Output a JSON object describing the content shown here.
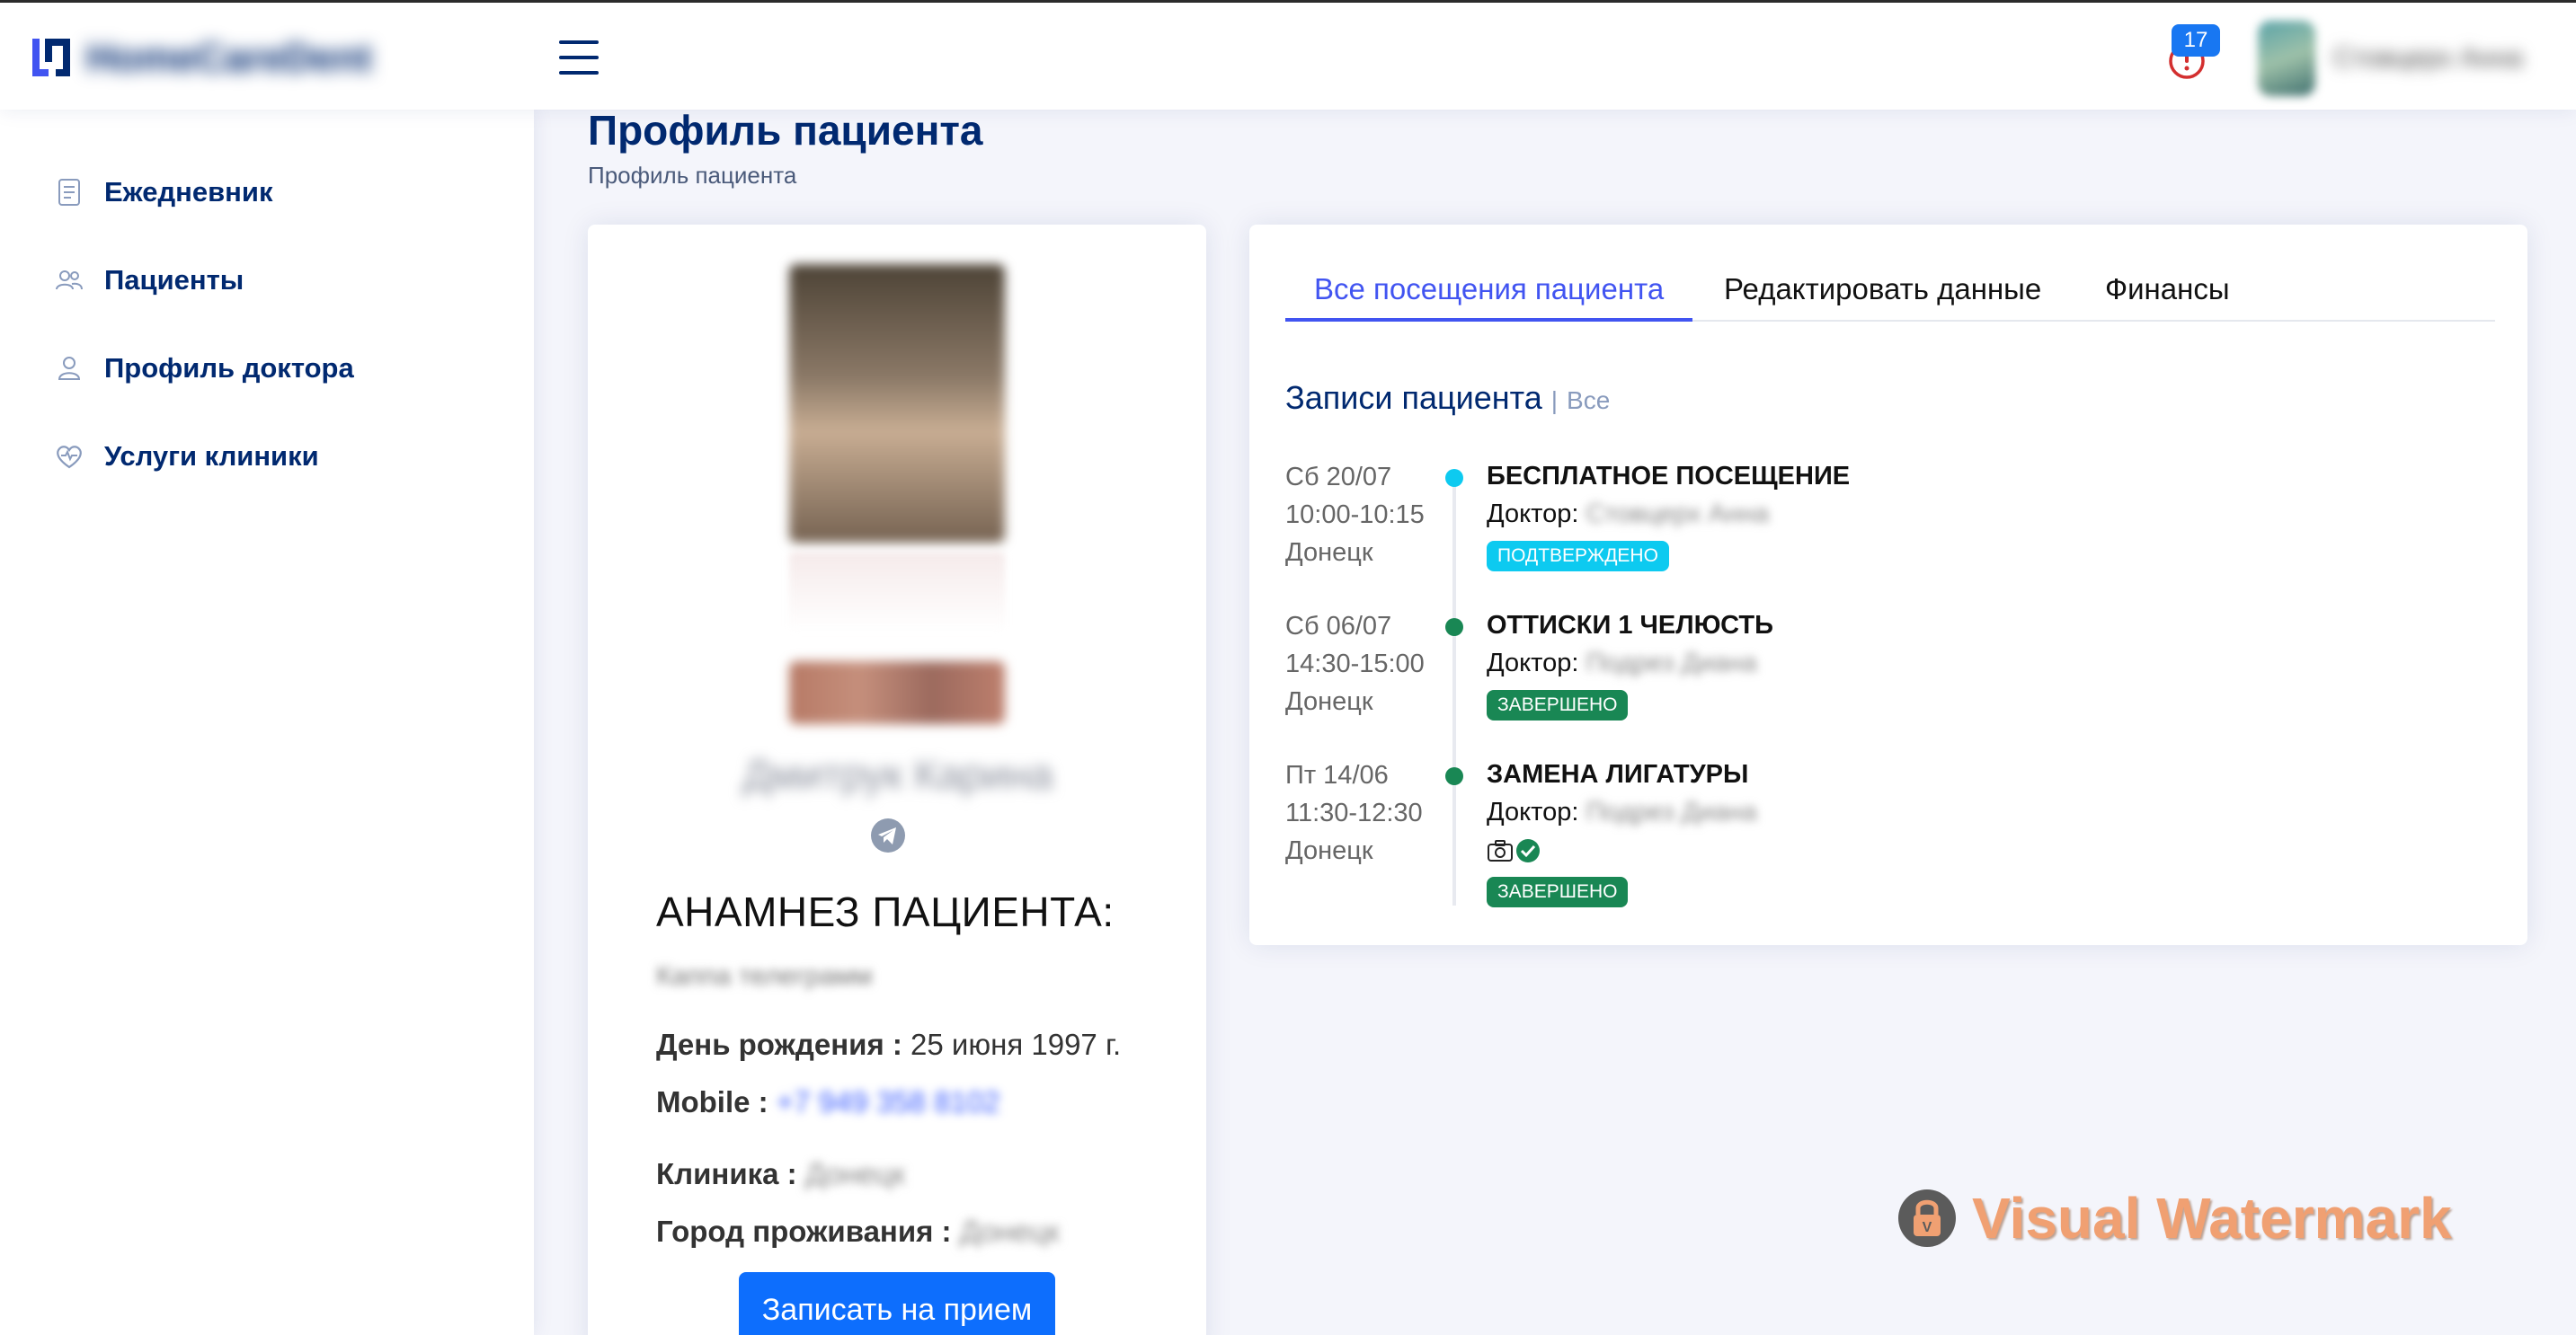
{
  "header": {
    "brand_name": "HomeCareDent",
    "notifications_count": "17",
    "user_name": "Стовцерх Анна"
  },
  "sidebar": {
    "items": [
      {
        "label": "Ежедневник",
        "icon": "journal-icon"
      },
      {
        "label": "Пациенты",
        "icon": "people-icon"
      },
      {
        "label": "Профиль доктора",
        "icon": "person-icon"
      },
      {
        "label": "Услуги клиники",
        "icon": "heart-pulse-icon"
      }
    ]
  },
  "page": {
    "title": "Профиль пациента",
    "breadcrumb": "Профиль пациента"
  },
  "patient": {
    "name": "Дмитрук Карина",
    "anamnesis_title": "АНАМНЕЗ ПАЦИЕНТА:",
    "anamnesis_text": "Каппа телеграмм",
    "birthday_label": "День рождения :",
    "birthday_value": "25 июня 1997 г.",
    "mobile_label": "Mobile :",
    "mobile_value": "+7 949 358 8102",
    "clinic_label": "Клиника :",
    "clinic_value": "Донецк",
    "city_label": "Город проживания :",
    "city_value": "Донецк",
    "book_button": "Записать на прием"
  },
  "tabs": [
    {
      "label": "Все посещения пациента",
      "active": true
    },
    {
      "label": "Редактировать данные",
      "active": false
    },
    {
      "label": "Финансы",
      "active": false
    }
  ],
  "records": {
    "title": "Записи пациента",
    "separator": "|",
    "filter": "Все",
    "doctor_label": "Доктор:",
    "items": [
      {
        "day": "Сб 20/07",
        "time": "10:00-10:15",
        "city": "Донецк",
        "title": "БЕСПЛАТНОЕ ПОСЕЩЕНИЕ",
        "doctor": "Стовцерх Анна",
        "status": "ПОДТВЕРЖДЕНО",
        "dot_color": "#0dcaf0"
      },
      {
        "day": "Сб 06/07",
        "time": "14:30-15:00",
        "city": "Донецк",
        "title": "ОТТИСКИ 1 ЧЕЛЮСТЬ",
        "doctor": "Подрез Диана",
        "status": "ЗАВЕРШЕНО",
        "dot_color": "#198754"
      },
      {
        "day": "Пт 14/06",
        "time": "11:30-12:30",
        "city": "Донецк",
        "title": "ЗАМЕНА ЛИГАТУРЫ",
        "doctor": "Подрез Диана",
        "status": "ЗАВЕРШЕНО",
        "dot_color": "#198754"
      }
    ]
  },
  "watermark": {
    "text": "Visual Watermark"
  },
  "colors": {
    "primary": "#4154f1",
    "navy": "#012970",
    "button": "#0d6efd",
    "confirmed": "#0dcaf0",
    "done": "#198754"
  }
}
